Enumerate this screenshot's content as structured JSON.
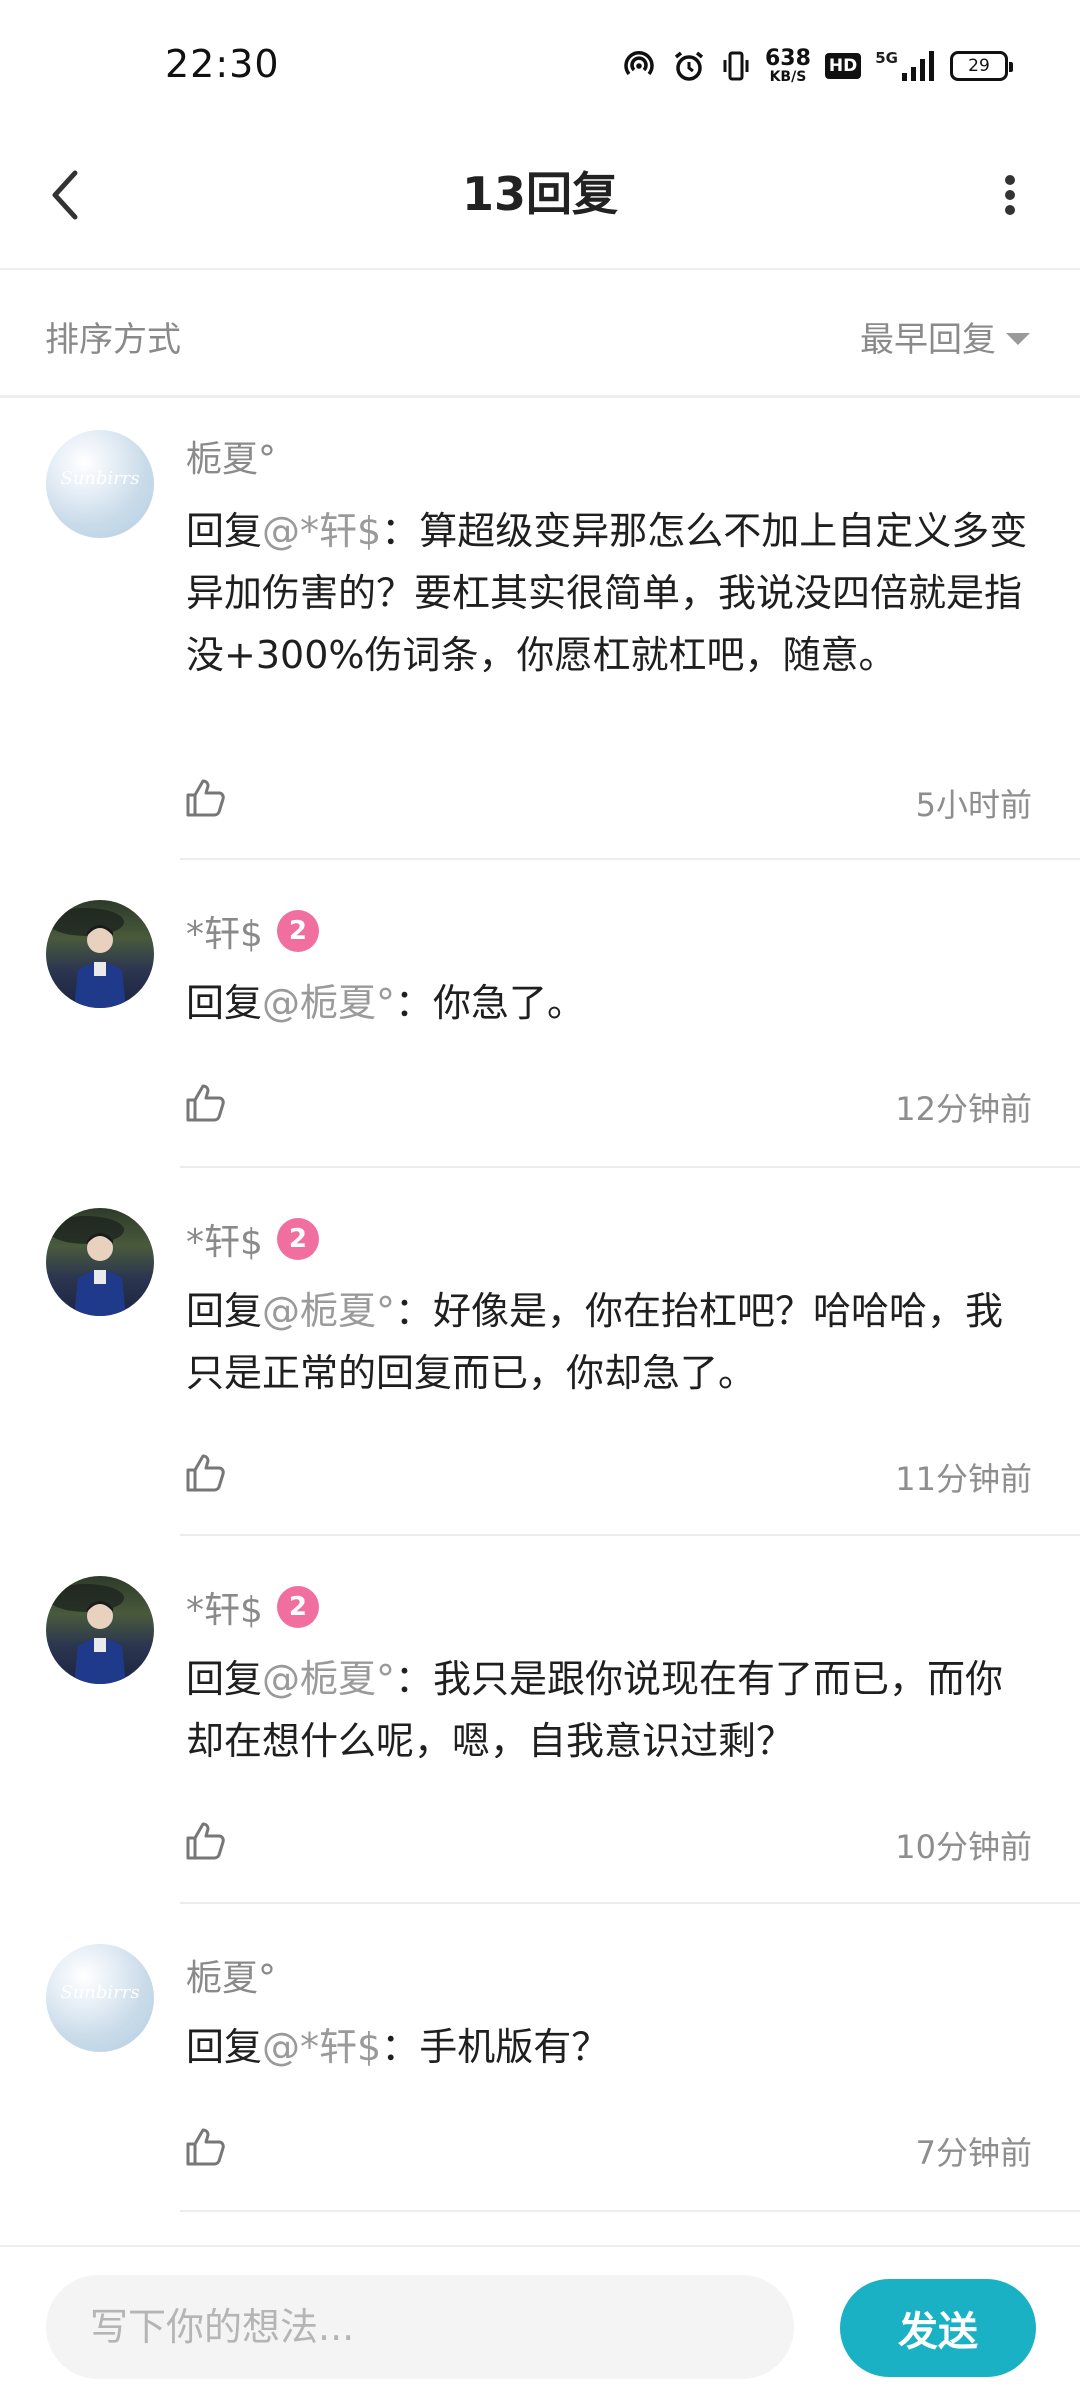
{
  "status_bar": {
    "time": "22:30",
    "net_speed": "638",
    "net_unit": "KB/S",
    "hd": "HD",
    "network": "5G",
    "battery": "29"
  },
  "header": {
    "title": "13回复"
  },
  "sort": {
    "label": "排序方式",
    "value": "最早回复"
  },
  "replies": [
    {
      "name": "栀夏°",
      "level": "",
      "avatar_text": "Sunbirrs",
      "prefix": "回复",
      "target": "@*轩$",
      "text": "：算超级变异那怎么不加上自定义多变异加伤害的？要杠其实很简单，我说没四倍就是指没+300%伤词条，你愿杠就杠吧，随意。",
      "time": "5小时前"
    },
    {
      "name": "*轩$",
      "level": "2",
      "avatar_text": "",
      "prefix": "回复",
      "target": "@栀夏°",
      "text": "：你急了。",
      "time": "12分钟前"
    },
    {
      "name": "*轩$",
      "level": "2",
      "avatar_text": "",
      "prefix": "回复",
      "target": "@栀夏°",
      "text": "：好像是，你在抬杠吧？哈哈哈，我只是正常的回复而已，你却急了。",
      "time": "11分钟前"
    },
    {
      "name": "*轩$",
      "level": "2",
      "avatar_text": "",
      "prefix": "回复",
      "target": "@栀夏°",
      "text": "：我只是跟你说现在有了而已，而你却在想什么呢，嗯，自我意识过剩？",
      "time": "10分钟前"
    },
    {
      "name": "栀夏°",
      "level": "",
      "avatar_text": "Sunbirrs",
      "prefix": "回复",
      "target": "@*轩$",
      "text": "：手机版有？",
      "time": "7分钟前"
    }
  ],
  "input_bar": {
    "placeholder": "写下你的想法...",
    "send_label": "发送"
  },
  "colors": {
    "accent": "#1bb1c4",
    "badge": "#f06f9f",
    "muted_text": "#8a8a8a"
  }
}
